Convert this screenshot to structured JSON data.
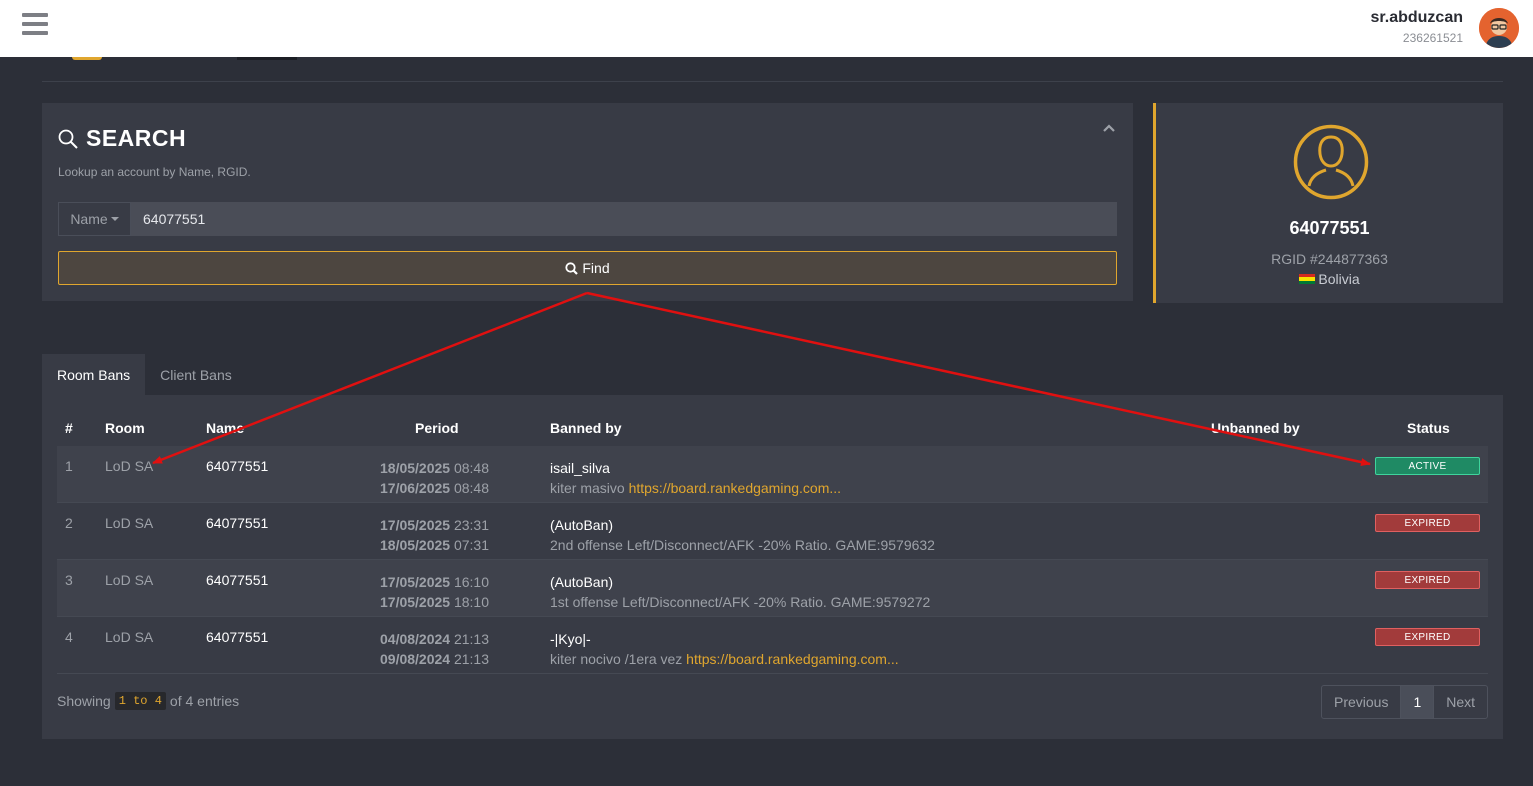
{
  "header": {
    "username": "sr.abduzcan",
    "user_id": "236261521"
  },
  "search": {
    "title": "SEARCH",
    "subtitle": "Lookup an account by Name, RGID.",
    "field": "Name",
    "value": "64077551",
    "find_label": "Find"
  },
  "profile": {
    "name": "64077551",
    "rgid": "RGID #244877363",
    "country": "Bolivia"
  },
  "tabs": [
    {
      "label": "Room Bans",
      "active": true
    },
    {
      "label": "Client Bans",
      "active": false
    }
  ],
  "table": {
    "headers": {
      "num": "#",
      "room": "Room",
      "name": "Name",
      "period": "Period",
      "banned_by": "Banned by",
      "unbanned_by": "Unbanned by",
      "status": "Status"
    },
    "rows": [
      {
        "num": "1",
        "room": "LoD SA",
        "name": "64077551",
        "start_date": "18/05/2025",
        "start_time": "08:48",
        "end_date": "17/06/2025",
        "end_time": "08:48",
        "banned_by": "isail_silva",
        "reason": "kiter masivo ",
        "link": "https://board.rankedgaming.com...",
        "status": "ACTIVE"
      },
      {
        "num": "2",
        "room": "LoD SA",
        "name": "64077551",
        "start_date": "17/05/2025",
        "start_time": "23:31",
        "end_date": "18/05/2025",
        "end_time": "07:31",
        "banned_by": "(AutoBan)",
        "reason": "2nd offense Left/Disconnect/AFK -20% Ratio. GAME:9579632",
        "link": "",
        "status": "EXPIRED"
      },
      {
        "num": "3",
        "room": "LoD SA",
        "name": "64077551",
        "start_date": "17/05/2025",
        "start_time": "16:10",
        "end_date": "17/05/2025",
        "end_time": "18:10",
        "banned_by": "(AutoBan)",
        "reason": "1st offense Left/Disconnect/AFK -20% Ratio. GAME:9579272",
        "link": "",
        "status": "EXPIRED"
      },
      {
        "num": "4",
        "room": "LoD SA",
        "name": "64077551",
        "start_date": "04/08/2024",
        "start_time": "21:13",
        "end_date": "09/08/2024",
        "end_time": "21:13",
        "banned_by": "-|Kyo|-",
        "reason": "kiter nocivo /1era vez ",
        "link": "https://board.rankedgaming.com...",
        "status": "EXPIRED"
      }
    ]
  },
  "footer": {
    "showing_prefix": "Showing",
    "range": "1 to 4",
    "showing_suffix": "of 4 entries",
    "prev": "Previous",
    "page": "1",
    "next": "Next"
  },
  "colors": {
    "accent": "#e0a62e",
    "active": "#1f8a64",
    "expired": "#a23b3b",
    "annotation_arrow": "#e01010"
  }
}
